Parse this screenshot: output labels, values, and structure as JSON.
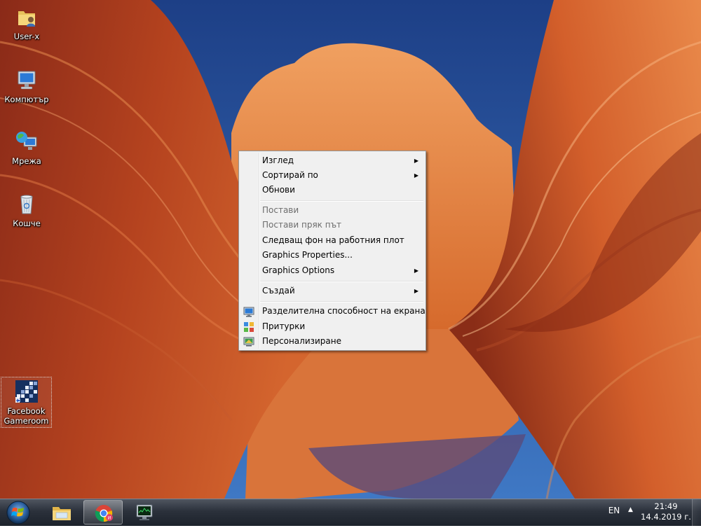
{
  "desktop": {
    "icons": [
      {
        "label": "User-x",
        "icon": "user-folder-icon"
      },
      {
        "label": "Компютър",
        "icon": "computer-icon"
      },
      {
        "label": "Мрежа",
        "icon": "network-icon"
      },
      {
        "label": "Кошче",
        "icon": "recycle-bin-icon"
      },
      {
        "label_line1": "Facebook",
        "label_line2": "Gameroom",
        "icon": "facebook-gameroom-icon"
      }
    ]
  },
  "context_menu": {
    "items": [
      {
        "label": "Изглед",
        "submenu": true
      },
      {
        "label": "Сортирай по",
        "submenu": true
      },
      {
        "label": "Обнови"
      },
      {
        "label": "Постави",
        "disabled": true
      },
      {
        "label": "Постави пряк път",
        "disabled": true
      },
      {
        "label": "Следващ фон на работния плот"
      },
      {
        "label": "Graphics Properties..."
      },
      {
        "label": "Graphics Options",
        "submenu": true
      },
      {
        "label": "Създай",
        "submenu": true
      },
      {
        "label": "Разделителна способност на екрана",
        "icon": "display-resolution-icon"
      },
      {
        "label": "Притурки",
        "icon": "gadgets-icon"
      },
      {
        "label": "Персонализиране",
        "icon": "personalize-icon"
      }
    ]
  },
  "taskbar": {
    "pinned": [
      {
        "name": "windows-explorer",
        "icon": "folder-icon"
      },
      {
        "name": "chrome",
        "icon": "chrome-icon"
      },
      {
        "name": "task-manager",
        "icon": "task-manager-icon"
      }
    ],
    "language": "EN",
    "time": "21:49",
    "date": "14.4.2019 г."
  },
  "colors": {
    "menu_bg": "#f0f0f0",
    "taskbar": "#2b313b",
    "sky": "#2c5aa6"
  }
}
